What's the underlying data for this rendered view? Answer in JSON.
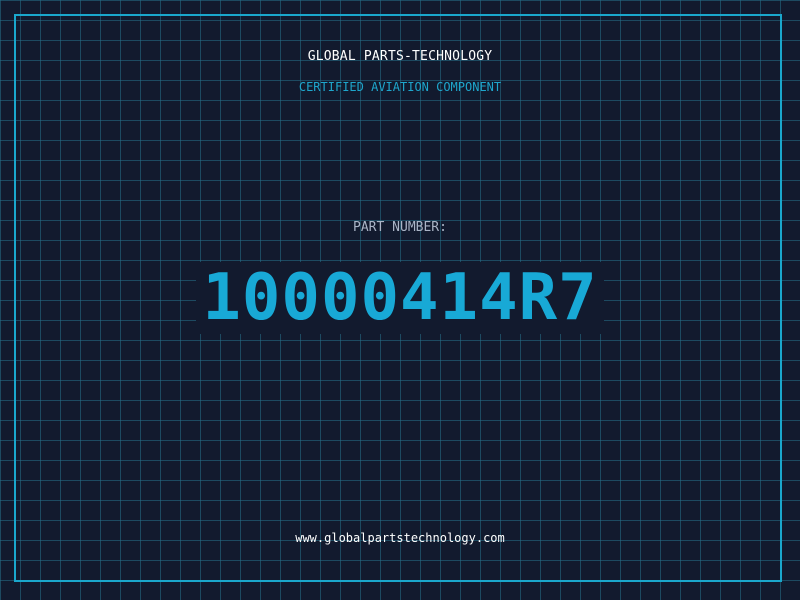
{
  "header": {
    "company": "GLOBAL PARTS-TECHNOLOGY",
    "subtitle": "CERTIFIED AVIATION COMPONENT"
  },
  "part": {
    "label": "PART NUMBER:",
    "number": "10000414R7"
  },
  "footer": {
    "website": "www.globalpartstechnology.com"
  },
  "colors": {
    "background": "#121a2e",
    "grid": "#26708a",
    "accent": "#1aa7cc",
    "text": "#ffffff",
    "label": "#aab4c6"
  }
}
